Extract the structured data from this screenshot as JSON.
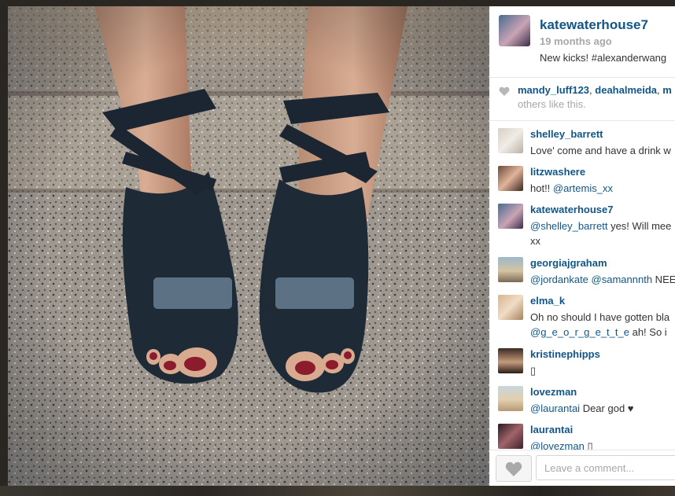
{
  "post": {
    "username": "katewaterhouse7",
    "time_ago": "19 months ago",
    "caption": "New kicks! #alexanderwang",
    "photo_label": "shoes-photo"
  },
  "likes": {
    "liker_1": "mandy_luff123",
    "separator": ", ",
    "liker_2": "deahalmeida",
    "separator_2": ", ",
    "liker_3": "m",
    "others_text": "others like this."
  },
  "comments": [
    {
      "user": "shelley_barrett",
      "text": "Love' come and have a drink w"
    },
    {
      "user": "litzwashere",
      "text_plain": "hot!! ",
      "mention": "@artemis_xx"
    },
    {
      "user": "katewaterhouse7",
      "mention": "@shelley_barrett",
      "text_plain": " yes! Will mee",
      "text_line2": "xx"
    },
    {
      "user": "georgiajgraham",
      "mention": "@jordankate",
      "mention_2": "@samannnth",
      "text_plain": " NEE"
    },
    {
      "user": "elma_k",
      "text": "Oh no should I have gotten bla",
      "mention": "@g_e_o_r_g_e_t_t_e",
      "text_plain": " ah! So i"
    },
    {
      "user": "kristinephipps",
      "text": "▯"
    },
    {
      "user": "lovezman",
      "mention": "@laurantai",
      "text_plain": " Dear god ♥"
    },
    {
      "user": "laurantai",
      "mention": "@lovezman",
      "text_plain": " ▯"
    }
  ],
  "footer": {
    "comment_placeholder": "Leave a comment...",
    "like_icon": "heart-icon"
  },
  "colors": {
    "link": "#125688",
    "muted": "#a5a7aa",
    "text": "#333333"
  }
}
